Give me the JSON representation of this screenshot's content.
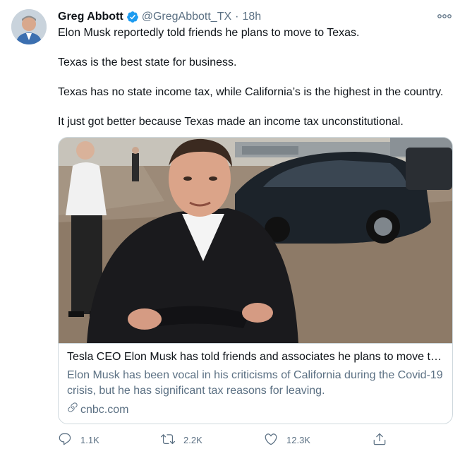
{
  "author": {
    "name": "Greg Abbott",
    "handle": "@GregAbbott_TX",
    "separator": "·",
    "time": "18h",
    "verified": true
  },
  "tweet": {
    "paragraphs": [
      "Elon Musk reportedly told friends he plans to move to Texas.",
      "Texas is the best state for business.",
      "Texas has no state income tax, while California’s is the highest in the country.",
      "It just got better because Texas made an income tax unconstitutional."
    ]
  },
  "card": {
    "title": "Tesla CEO Elon Musk has told friends and associates he plans to move to Texas",
    "description": "Elon Musk has been vocal in his criticisms of California during the Covid-19 crisis, but he has significant tax reasons for leaving.",
    "domain": "cnbc.com"
  },
  "actions": {
    "replies": "1.1K",
    "retweets": "2.2K",
    "likes": "12.3K"
  },
  "icons": [
    "verified-badge-icon",
    "more-icon",
    "link-icon",
    "reply-icon",
    "retweet-icon",
    "like-icon",
    "share-icon"
  ],
  "colors": {
    "text": "#0f1419",
    "secondary": "#5b7083",
    "verified": "#1d9bf0",
    "border": "#cfd9de"
  }
}
